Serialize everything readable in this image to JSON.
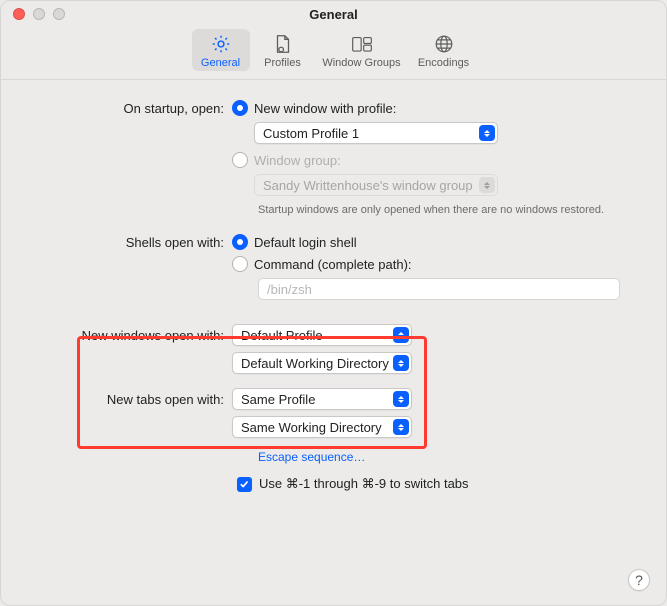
{
  "title": "General",
  "toolbar": {
    "general": "General",
    "profiles": "Profiles",
    "window_groups": "Window Groups",
    "encodings": "Encodings"
  },
  "labels": {
    "on_startup": "On startup, open:",
    "new_window_profile": "New window with profile:",
    "window_group": "Window group:",
    "shells_open": "Shells open with:",
    "default_shell": "Default login shell",
    "command": "Command (complete path):",
    "new_windows": "New windows open with:",
    "new_tabs": "New tabs open with:",
    "switch_tabs": "Use ⌘-1 through ⌘-9 to switch tabs"
  },
  "selects": {
    "profile": "Custom Profile 1",
    "window_group": "Sandy Writtenhouse's window group",
    "nw_profile": "Default Profile",
    "nw_dir": "Default Working Directory",
    "nt_profile": "Same Profile",
    "nt_dir": "Same Working Directory"
  },
  "note": "Startup windows are only opened when there are no windows restored.",
  "cmd_placeholder": "/bin/zsh",
  "escape_link": "Escape sequence…",
  "help": "?"
}
